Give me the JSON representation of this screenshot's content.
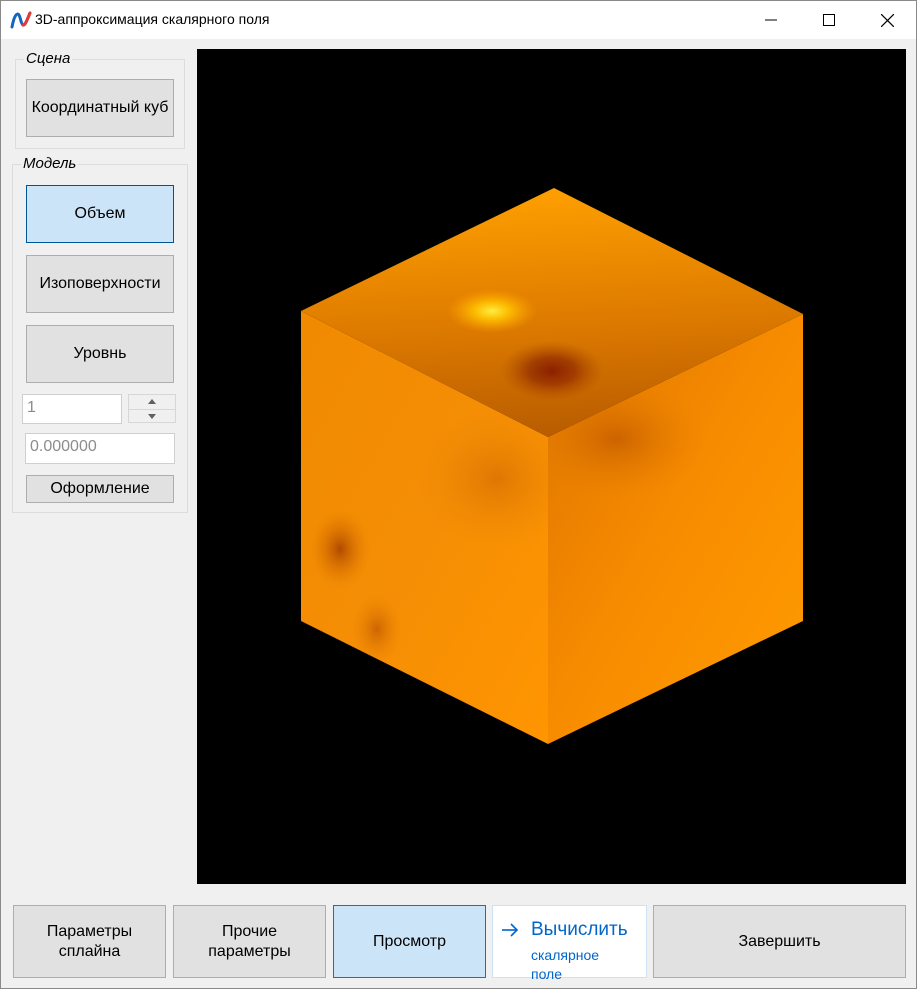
{
  "window": {
    "title": "3D-аппроксимация скалярного поля"
  },
  "scene_group": {
    "title": "Сцена",
    "coord_cube_button": "Координатный куб"
  },
  "model_group": {
    "title": "Модель",
    "volume_button": "Объем",
    "isosurfaces_button": "Изоповерхности",
    "level_button": "Уровнь",
    "level_index_value": "1",
    "level_value": "0.000000",
    "style_button": "Оформление"
  },
  "bottom": {
    "spline_params": "Параметры сплайна",
    "other_params": "Прочие параметры",
    "preview": "Просмотр",
    "compute_title": "Вычислить",
    "compute_subtitle": "скалярное поле",
    "finish": "Завершить"
  },
  "colors": {
    "accent": "#0078d7",
    "active_button": "#cce4f7",
    "cube_orange": "#ff9500",
    "viewport_bg": "#000000"
  }
}
